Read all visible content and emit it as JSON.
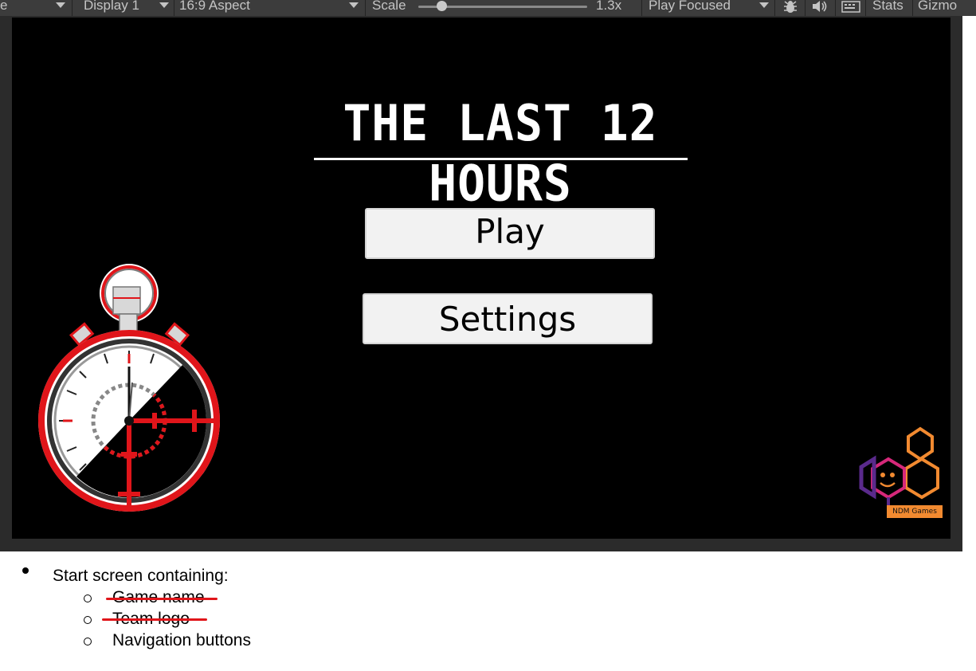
{
  "toolbar": {
    "partial_left": "e",
    "display": "Display 1",
    "aspect": "16:9 Aspect",
    "scale_label": "Scale",
    "scale_value": "1.3x",
    "play_mode": "Play Focused",
    "stats": "Stats",
    "gizmos": "Gizmo",
    "icons": [
      "bug-icon",
      "audio-icon",
      "keyboard-icon"
    ]
  },
  "game": {
    "title": "THE LAST 12 HOURS",
    "buttons": {
      "play": "Play",
      "settings": "Settings"
    },
    "logo_text": "NDM Games",
    "colors": {
      "background": "#000000",
      "accent": "#e0151a",
      "logo_purple": "#5a2a8c",
      "logo_orange": "#f28a30",
      "logo_pink": "#d6287a"
    }
  },
  "notes": {
    "heading": "Start screen containing:",
    "items": [
      {
        "text": "Game name",
        "struck": true
      },
      {
        "text": "Team logo",
        "struck": true
      },
      {
        "text": "Navigation buttons",
        "struck": false
      }
    ]
  }
}
